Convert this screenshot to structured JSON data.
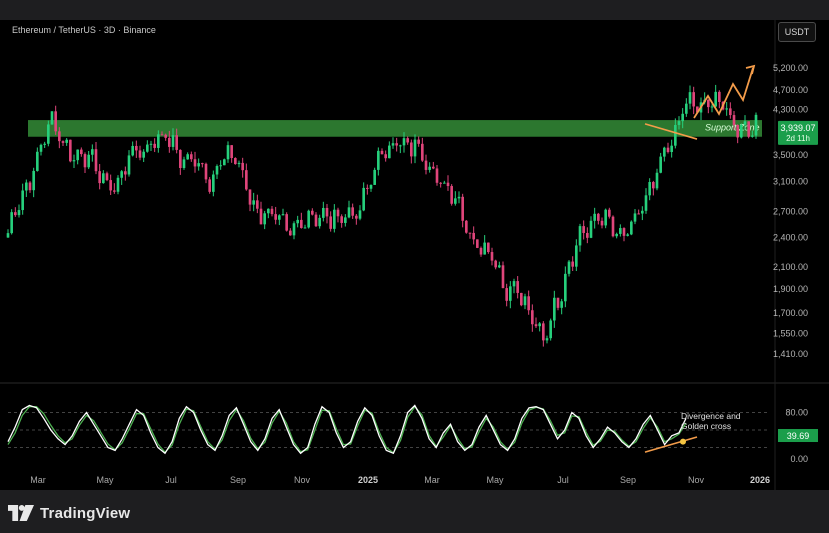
{
  "header": {
    "title": "Ethereum / TetherUS · 3D · Binance",
    "quote_currency": "USDT"
  },
  "footer": {
    "brand": "TradingView"
  },
  "colors": {
    "up": "#26d07c",
    "down": "#e0457b",
    "support_zone": "#2e7d32",
    "annotation": "#f39c4a",
    "osc_main": "#ffffff",
    "osc_signal": "#4caf50",
    "price_tag": "#1b9e4b"
  },
  "chart_data": [
    {
      "type": "candlestick",
      "title": "Ethereum / TetherUS · 3D · Binance",
      "ylim": [
        1300,
        5800
      ],
      "y_ticks": [
        5200,
        4700,
        4300,
        3900,
        3500,
        3100,
        2700,
        2400,
        2100,
        1900,
        1700,
        1550,
        1410
      ],
      "y_tick_labels": [
        "5,200.00",
        "4,700.00",
        "4,300.00",
        "3,500.00",
        "3,100.00",
        "2,700.00",
        "2,400.00",
        "2,100.00",
        "1,900.00",
        "1,700.00",
        "1,550.00",
        "1,410.00"
      ],
      "x_ticks": [
        "Mar",
        "May",
        "Jul",
        "Sep",
        "Nov",
        "2025",
        "Mar",
        "May",
        "Jul",
        "Sep",
        "Nov",
        "2026"
      ],
      "support_zone": {
        "label": "Support Zone",
        "from": 3800,
        "to": 4100
      },
      "last_price": {
        "value": "3,939.07",
        "countdown": "2d 11h"
      },
      "anchors": [
        [
          0,
          2450
        ],
        [
          5,
          3000
        ],
        [
          10,
          3850
        ],
        [
          12,
          4000
        ],
        [
          15,
          3700
        ],
        [
          20,
          3500
        ],
        [
          25,
          3200
        ],
        [
          30,
          3050
        ],
        [
          35,
          3600
        ],
        [
          40,
          3750
        ],
        [
          44,
          3700
        ],
        [
          48,
          3500
        ],
        [
          52,
          3300
        ],
        [
          55,
          3100
        ],
        [
          58,
          3500
        ],
        [
          62,
          3400
        ],
        [
          65,
          3000
        ],
        [
          69,
          2700
        ],
        [
          73,
          2600
        ],
        [
          76,
          2500
        ],
        [
          79,
          2550
        ],
        [
          83,
          2600
        ],
        [
          87,
          2700
        ],
        [
          91,
          2600
        ],
        [
          95,
          2650
        ],
        [
          99,
          3200
        ],
        [
          103,
          3500
        ],
        [
          106,
          3800
        ],
        [
          108,
          3700
        ],
        [
          111,
          3600
        ],
        [
          114,
          3400
        ],
        [
          117,
          3200
        ],
        [
          120,
          3000
        ],
        [
          124,
          2650
        ],
        [
          127,
          2400
        ],
        [
          130,
          2300
        ],
        [
          133,
          2100
        ],
        [
          136,
          1900
        ],
        [
          138,
          2000
        ],
        [
          140,
          1800
        ],
        [
          143,
          1600
        ],
        [
          146,
          1550
        ],
        [
          148,
          1700
        ],
        [
          151,
          1850
        ],
        [
          154,
          2200
        ],
        [
          156,
          2500
        ],
        [
          159,
          2550
        ],
        [
          162,
          2600
        ],
        [
          165,
          2500
        ],
        [
          168,
          2450
        ],
        [
          171,
          2550
        ],
        [
          174,
          2800
        ],
        [
          177,
          3300
        ],
        [
          180,
          3650
        ],
        [
          182,
          3700
        ],
        [
          184,
          4300
        ],
        [
          186,
          4550
        ],
        [
          188,
          4450
        ],
        [
          190,
          4300
        ],
        [
          193,
          4450
        ],
        [
          196,
          4350
        ],
        [
          199,
          4000
        ],
        [
          202,
          3850
        ],
        [
          204,
          3950
        ]
      ],
      "projection": [
        [
          3950,
          4300
        ],
        [
          3950,
          4350
        ],
        [
          4000,
          4600
        ],
        [
          4250,
          4700
        ],
        [
          4500,
          4800
        ]
      ]
    },
    {
      "type": "line",
      "title": "Oscillator",
      "ylim": [
        -10,
        110
      ],
      "y_ticks": [
        80,
        20,
        0
      ],
      "y_tick_labels": [
        "80.00",
        "",
        "0.00"
      ],
      "last_value": "39.69",
      "annotation": "Divergence and Golden cross",
      "series": [
        {
          "values": [
            30,
            55,
            85,
            92,
            88,
            70,
            50,
            35,
            25,
            40,
            65,
            80,
            60,
            40,
            20,
            15,
            35,
            60,
            85,
            75,
            45,
            20,
            10,
            30,
            70,
            90,
            80,
            50,
            25,
            15,
            40,
            75,
            88,
            60,
            30,
            15,
            35,
            70,
            85,
            55,
            25,
            10,
            20,
            60,
            90,
            80,
            45,
            20,
            30,
            65,
            88,
            75,
            40,
            15,
            10,
            40,
            80,
            92,
            70,
            35,
            20,
            45,
            60,
            30,
            15,
            25,
            55,
            75,
            50,
            25,
            15,
            35,
            70,
            88,
            90,
            85,
            60,
            35,
            50,
            80,
            70,
            40,
            20,
            35,
            55,
            45,
            30,
            20,
            35,
            60,
            75,
            50,
            25,
            40,
            45,
            70
          ]
        },
        {
          "values": [
            25,
            45,
            75,
            90,
            90,
            78,
            58,
            40,
            28,
            35,
            58,
            75,
            66,
            46,
            26,
            16,
            28,
            52,
            78,
            78,
            52,
            26,
            12,
            24,
            60,
            86,
            83,
            56,
            30,
            17,
            33,
            66,
            85,
            66,
            36,
            18,
            29,
            62,
            82,
            62,
            30,
            13,
            16,
            50,
            84,
            83,
            52,
            25,
            26,
            57,
            84,
            79,
            47,
            20,
            11,
            32,
            72,
            90,
            76,
            41,
            22,
            38,
            57,
            36,
            18,
            21,
            47,
            70,
            55,
            30,
            17,
            29,
            62,
            84,
            89,
            86,
            66,
            41,
            45,
            74,
            73,
            46,
            24,
            31,
            50,
            48,
            33,
            22,
            30,
            53,
            71,
            55,
            30,
            35,
            43,
            62
          ]
        }
      ]
    }
  ]
}
